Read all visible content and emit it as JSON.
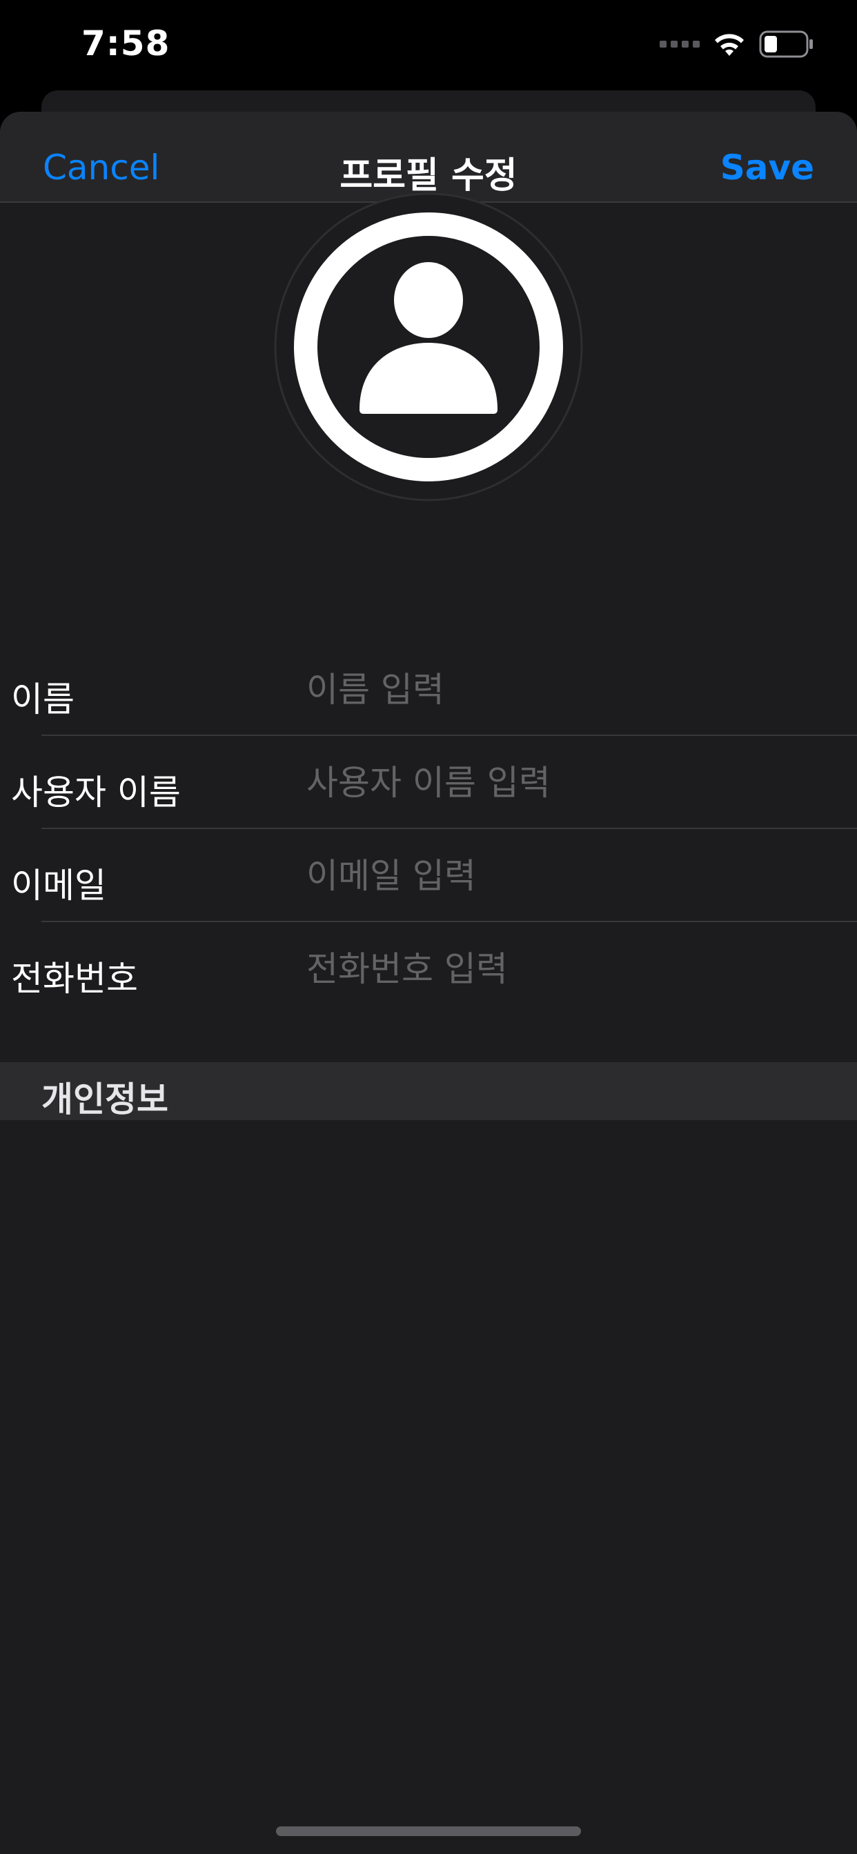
{
  "status_bar": {
    "time": "7:58",
    "icons": [
      "signal-icon",
      "wifi-icon",
      "battery-icon"
    ]
  },
  "nav": {
    "cancel_label": "Cancel",
    "title": "프로필 수정",
    "save_label": "Save"
  },
  "avatar": {
    "icon": "person-icon"
  },
  "form": {
    "fields": [
      {
        "label": "이름",
        "placeholder": "이름 입력",
        "value": ""
      },
      {
        "label": "사용자 이름",
        "placeholder": "사용자 이름 입력",
        "value": ""
      },
      {
        "label": "이메일",
        "placeholder": "이메일 입력",
        "value": ""
      },
      {
        "label": "전화번호",
        "placeholder": "전화번호 입력",
        "value": ""
      }
    ]
  },
  "section": {
    "title": "개인정보"
  },
  "colors": {
    "accent": "#0a84ff",
    "background": "#1c1c1e",
    "nav_background": "#262628",
    "section_background": "#2c2c2e",
    "placeholder": "#636366"
  }
}
